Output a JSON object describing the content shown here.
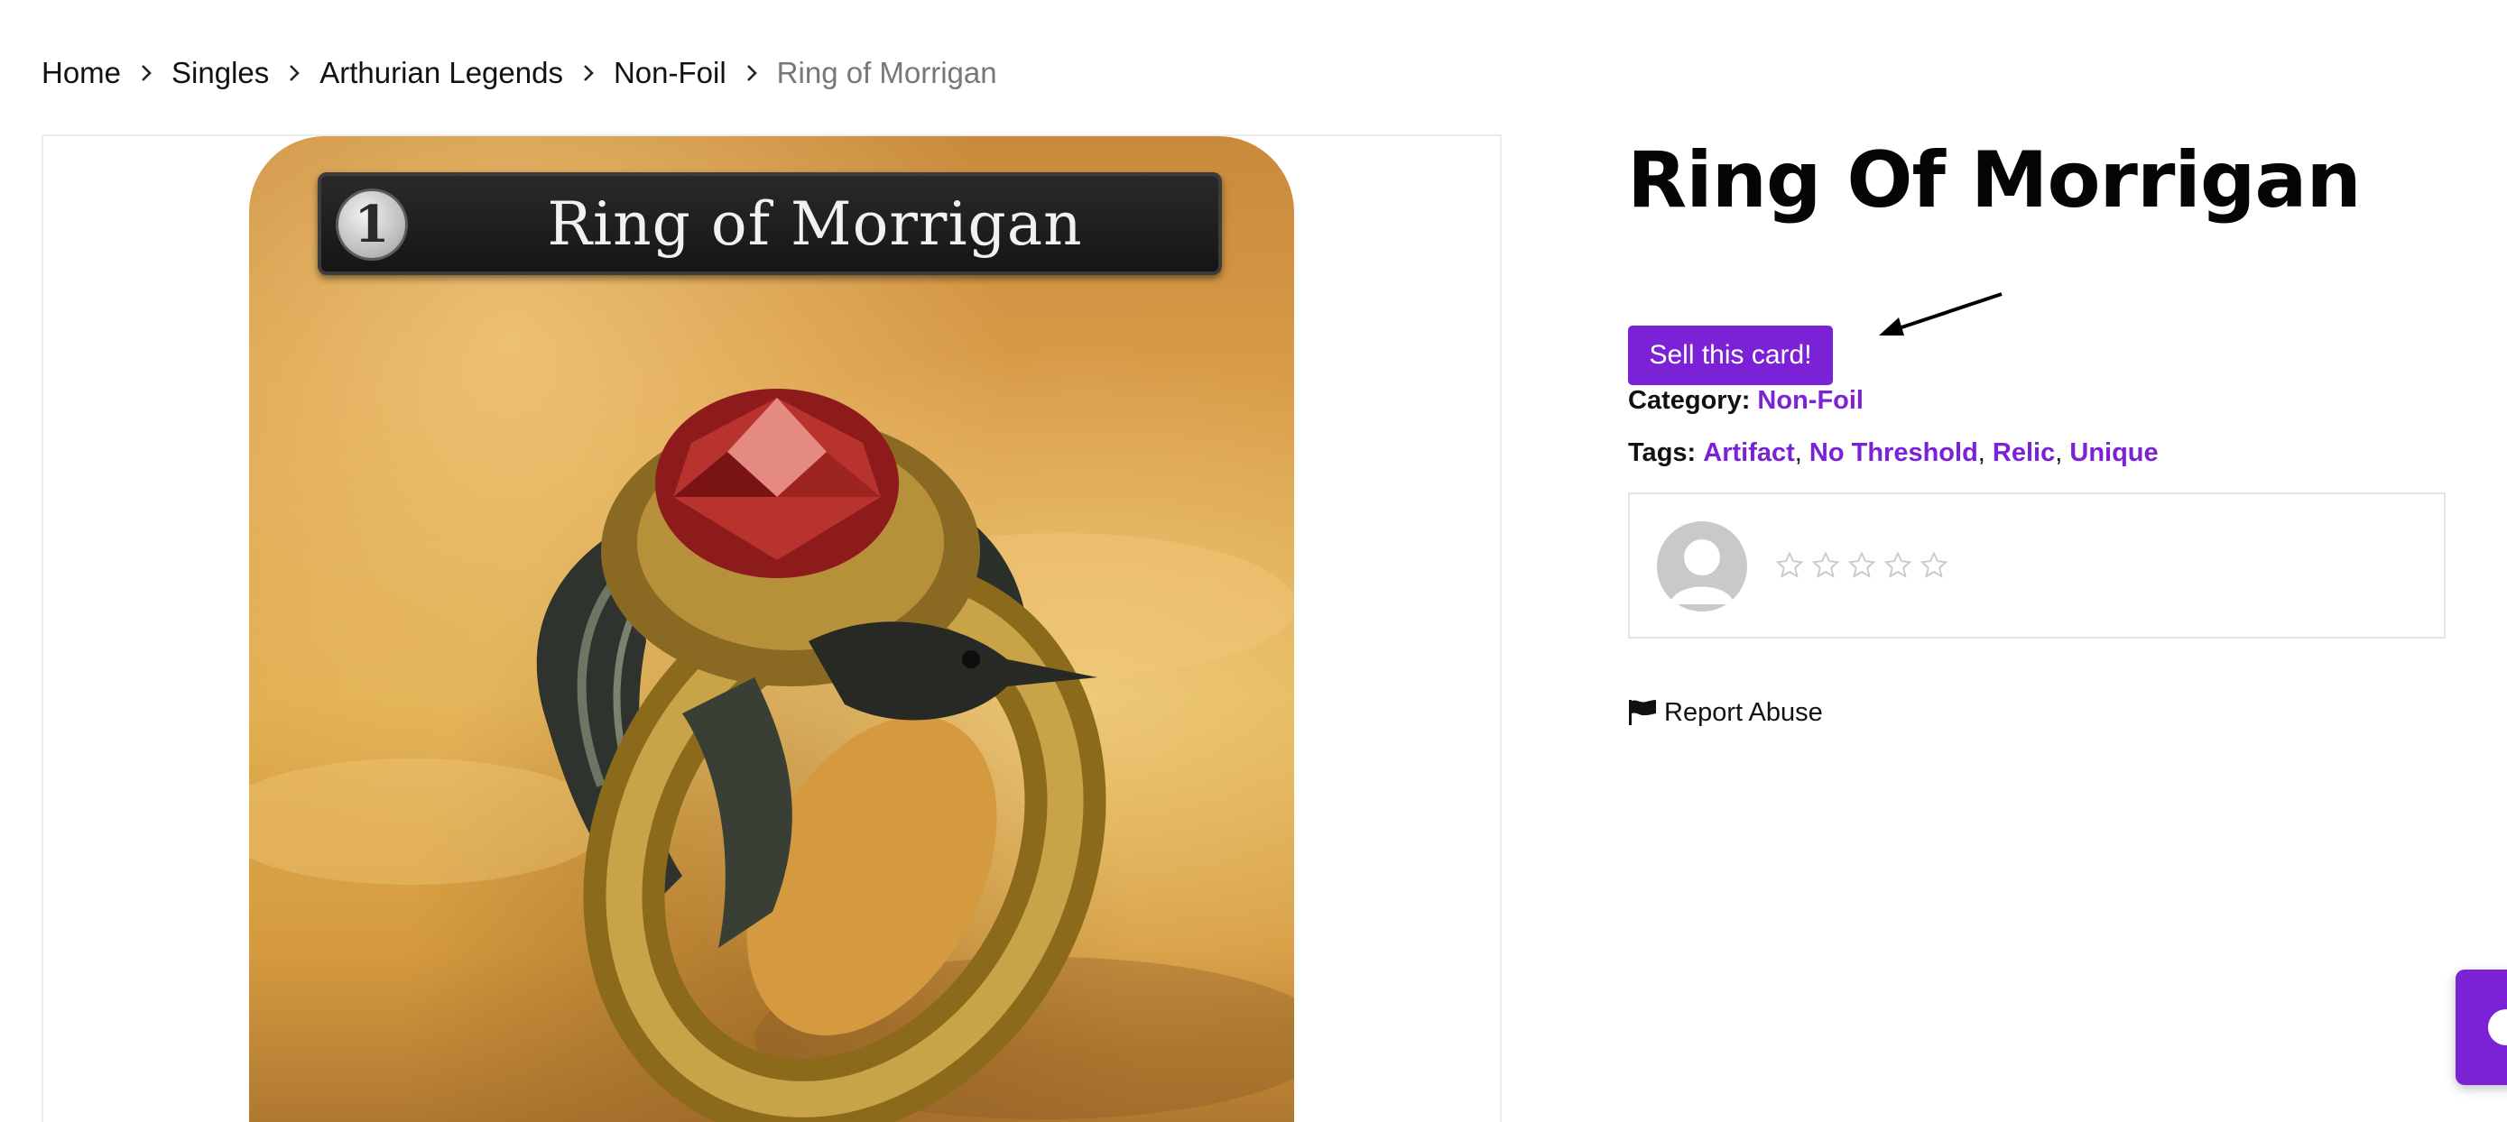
{
  "breadcrumb": {
    "items": [
      "Home",
      "Singles",
      "Arthurian Legends",
      "Non-Foil"
    ],
    "current": "Ring of Morrigan"
  },
  "card": {
    "cost": "1",
    "title": "Ring of Morrigan"
  },
  "product": {
    "title": "Ring Of Morrigan",
    "sell_button": "Sell this card!",
    "category_label": "Category:",
    "category_value": "Non-Foil",
    "tags_label": "Tags:",
    "tags": [
      "Artifact",
      "No Threshold",
      "Relic",
      "Unique"
    ]
  },
  "review": {
    "rating": 0,
    "max_rating": 5
  },
  "report": {
    "label": "Report Abuse",
    "icon": "flag-icon"
  },
  "colors": {
    "accent": "#7b22d6",
    "text": "#111111",
    "muted": "#777777"
  }
}
